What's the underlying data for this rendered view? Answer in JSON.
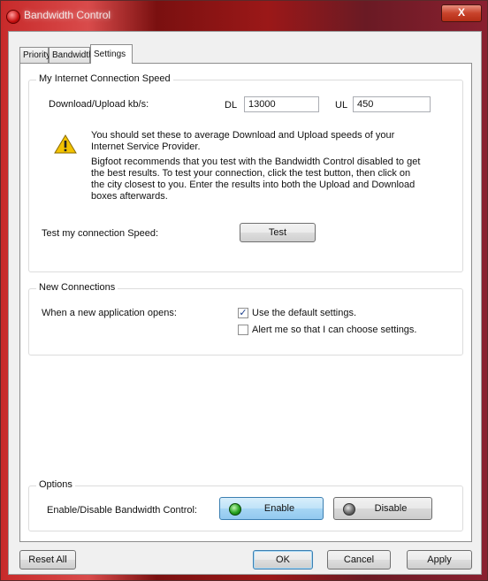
{
  "window": {
    "title": "Bandwidth Control",
    "close_label": "X"
  },
  "tabs": [
    {
      "label": "Priority"
    },
    {
      "label": "Bandwidth"
    },
    {
      "label": "Settings"
    }
  ],
  "connection_speed": {
    "group_title": "My Internet Connection Speed",
    "label": "Download/Upload kb/s:",
    "dl_label": "DL",
    "dl_value": "13000",
    "ul_label": "UL",
    "ul_value": "450",
    "warning_line1": "You should set these to average Download and Upload speeds of your",
    "warning_line2": "Internet Service Provider.",
    "info_line1": "Bigfoot recommends that you test with the Bandwidth Control disabled to get",
    "info_line2": "the best results. To test your connection, click the test button, then click on",
    "info_line3": "the city closest to you. Enter the results into both the Upload and Download",
    "info_line4": "boxes afterwards.",
    "test_label": "Test my connection Speed:",
    "test_button": "Test"
  },
  "new_connections": {
    "group_title": "New Connections",
    "label": "When a new application opens:",
    "option_default": "Use the default settings.",
    "option_default_checked": true,
    "option_alert": "Alert me so that I can choose settings.",
    "option_alert_checked": false,
    "check_mark": "✓"
  },
  "options": {
    "group_title": "Options",
    "label": "Enable/Disable Bandwidth Control:",
    "enable_label": "Enable",
    "disable_label": "Disable"
  },
  "footer": {
    "reset_label": "Reset All",
    "ok_label": "OK",
    "cancel_label": "Cancel",
    "apply_label": "Apply"
  },
  "colors": {
    "enabled_indicator": "#27a320",
    "disabled_indicator": "#6c6c6c",
    "warning_icon": "#f2c200"
  }
}
